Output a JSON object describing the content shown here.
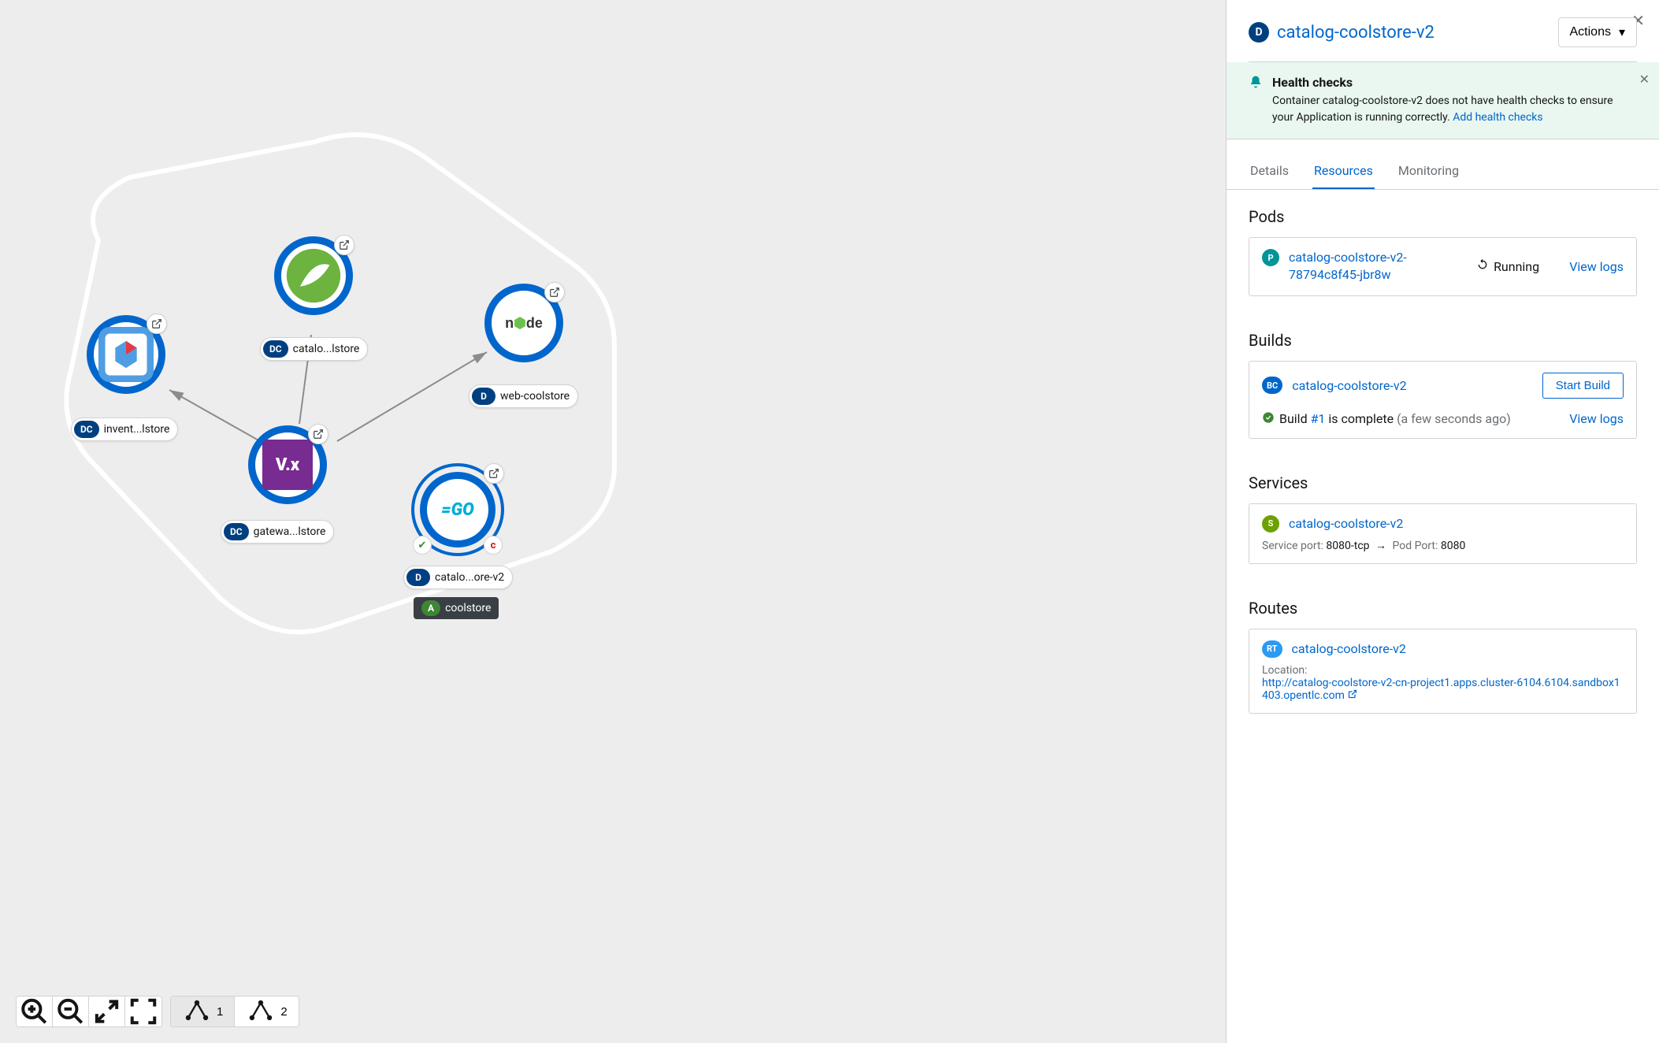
{
  "header": {
    "title": "catalog-coolstore-v2",
    "badge": "D",
    "actions_label": "Actions"
  },
  "alert": {
    "title": "Health checks",
    "body_prefix": "Container catalog-coolstore-v2 does not have health checks to ensure your Application is running correctly. ",
    "link": "Add health checks"
  },
  "tabs": {
    "details": "Details",
    "resources": "Resources",
    "monitoring": "Monitoring"
  },
  "pods": {
    "title": "Pods",
    "badge": "P",
    "name": "catalog-coolstore-v2-78794c8f45-jbr8w",
    "status": "Running",
    "view_logs": "View logs"
  },
  "builds": {
    "title": "Builds",
    "badge": "BC",
    "name": "catalog-coolstore-v2",
    "start": "Start Build",
    "status_prefix": "Build ",
    "build_number": "#1",
    "status_suffix": " is complete ",
    "time": "(a few seconds ago)",
    "view_logs": "View logs"
  },
  "services": {
    "title": "Services",
    "badge": "S",
    "name": "catalog-coolstore-v2",
    "port_label": "Service port: ",
    "port_value": "8080-tcp",
    "pod_port_label": "Pod Port: ",
    "pod_port_value": "8080"
  },
  "routes": {
    "title": "Routes",
    "badge": "RT",
    "name": "catalog-coolstore-v2",
    "location_label": "Location:",
    "url": "http://catalog-coolstore-v2-cn-project1.apps.cluster-6104.6104.sandbox1403.opentlc.com"
  },
  "toolbar": {
    "opt1": "1",
    "opt2": "2"
  },
  "topology": {
    "app_group_label": "coolstore",
    "app_badge": "A",
    "nodes": {
      "inventory": {
        "badge": "DC",
        "label": "invent...lstore"
      },
      "catalog_dc": {
        "badge": "DC",
        "label": "catalo...lstore"
      },
      "gateway": {
        "badge": "DC",
        "label": "gatewa...lstore"
      },
      "web": {
        "badge": "D",
        "label": "web-coolstore"
      },
      "catalog_d": {
        "badge": "D",
        "label": "catalo...ore-v2"
      }
    }
  }
}
